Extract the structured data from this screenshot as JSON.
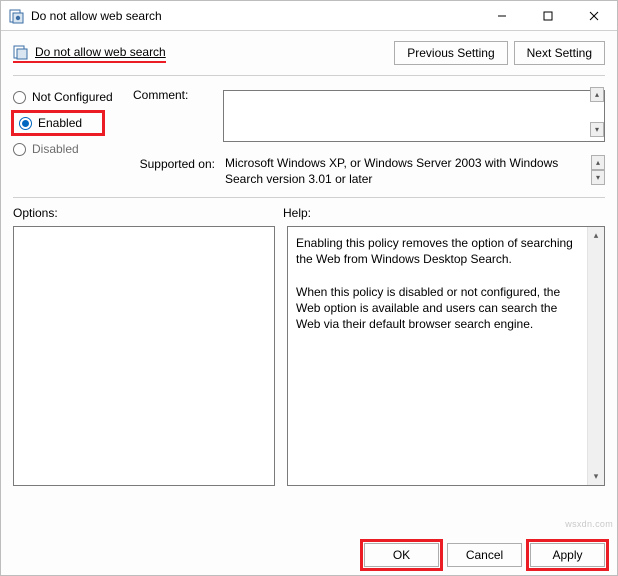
{
  "window": {
    "title": "Do not allow web search"
  },
  "header": {
    "link_text": "Do not allow web search"
  },
  "nav": {
    "prev": "Previous Setting",
    "next": "Next Setting"
  },
  "state": {
    "not_configured": "Not Configured",
    "enabled": "Enabled",
    "disabled": "Disabled"
  },
  "meta": {
    "comment_label": "Comment:",
    "comment_value": "",
    "supported_label": "Supported on:",
    "supported_value": "Microsoft Windows XP, or Windows Server 2003 with Windows Search version 3.01 or later"
  },
  "labels": {
    "options": "Options:",
    "help": "Help:"
  },
  "help": {
    "p1": "Enabling this policy removes the option of searching the Web from Windows Desktop Search.",
    "p2": "When this policy is disabled or not configured, the Web option is available and users can search the Web via their default browser search engine."
  },
  "buttons": {
    "ok": "OK",
    "cancel": "Cancel",
    "apply": "Apply"
  },
  "watermark": "wsxdn.com"
}
